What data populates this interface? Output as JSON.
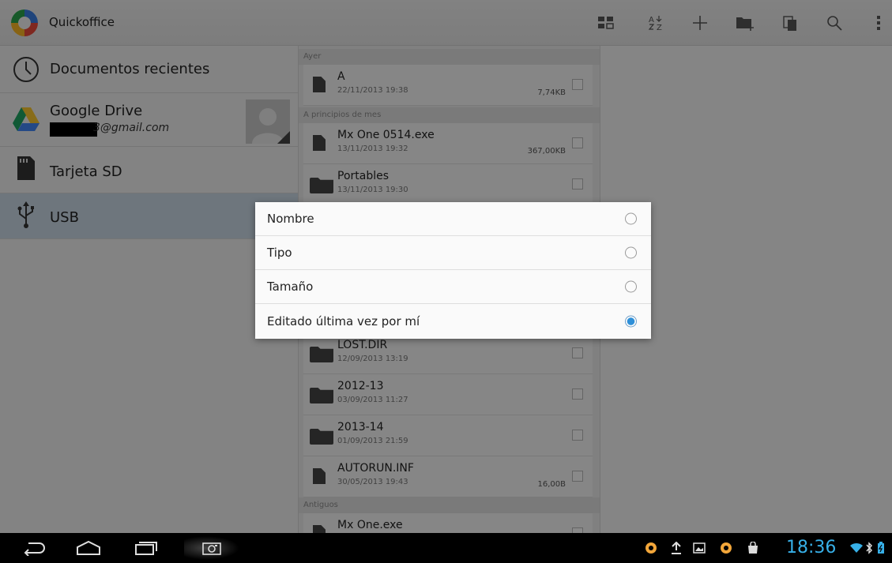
{
  "app": {
    "title": "Quickoffice"
  },
  "nav": {
    "items": [
      {
        "label": "Documentos recientes"
      },
      {
        "label": "Google Drive",
        "sub": "3@gmail.com"
      },
      {
        "label": "Tarjeta SD"
      },
      {
        "label": "USB"
      }
    ]
  },
  "list": {
    "sections": [
      "Ayer",
      "A principios de mes",
      "Antiguos"
    ],
    "files": [
      {
        "name": "A",
        "date": "22/11/2013 19:38",
        "size": "7,74KB",
        "type": "file"
      },
      {
        "name": "Mx One 0514.exe",
        "date": "13/11/2013 19:32",
        "size": "367,00KB",
        "type": "file"
      },
      {
        "name": "Portables",
        "date": "13/11/2013 19:30",
        "size": "",
        "type": "folder"
      },
      {
        "name": "LOST.DIR",
        "date": "12/09/2013 13:19",
        "size": "",
        "type": "folder"
      },
      {
        "name": "2012-13",
        "date": "03/09/2013 11:27",
        "size": "",
        "type": "folder"
      },
      {
        "name": "2013-14",
        "date": "01/09/2013 21:59",
        "size": "",
        "type": "folder"
      },
      {
        "name": "AUTORUN.INF",
        "date": "30/05/2013 19:43",
        "size": "16,00B",
        "type": "file"
      },
      {
        "name": "Mx One.exe",
        "date": "",
        "size": "",
        "type": "file"
      }
    ]
  },
  "sort_dialog": {
    "options": [
      {
        "label": "Nombre",
        "selected": false
      },
      {
        "label": "Tipo",
        "selected": false
      },
      {
        "label": "Tamaño",
        "selected": false
      },
      {
        "label": "Editado última vez por mí",
        "selected": true
      }
    ]
  },
  "status": {
    "time": "18:36"
  },
  "colors": {
    "accent": "#2e8fd8",
    "clock": "#37b0e8",
    "nav_active": "#c9d8e4"
  }
}
